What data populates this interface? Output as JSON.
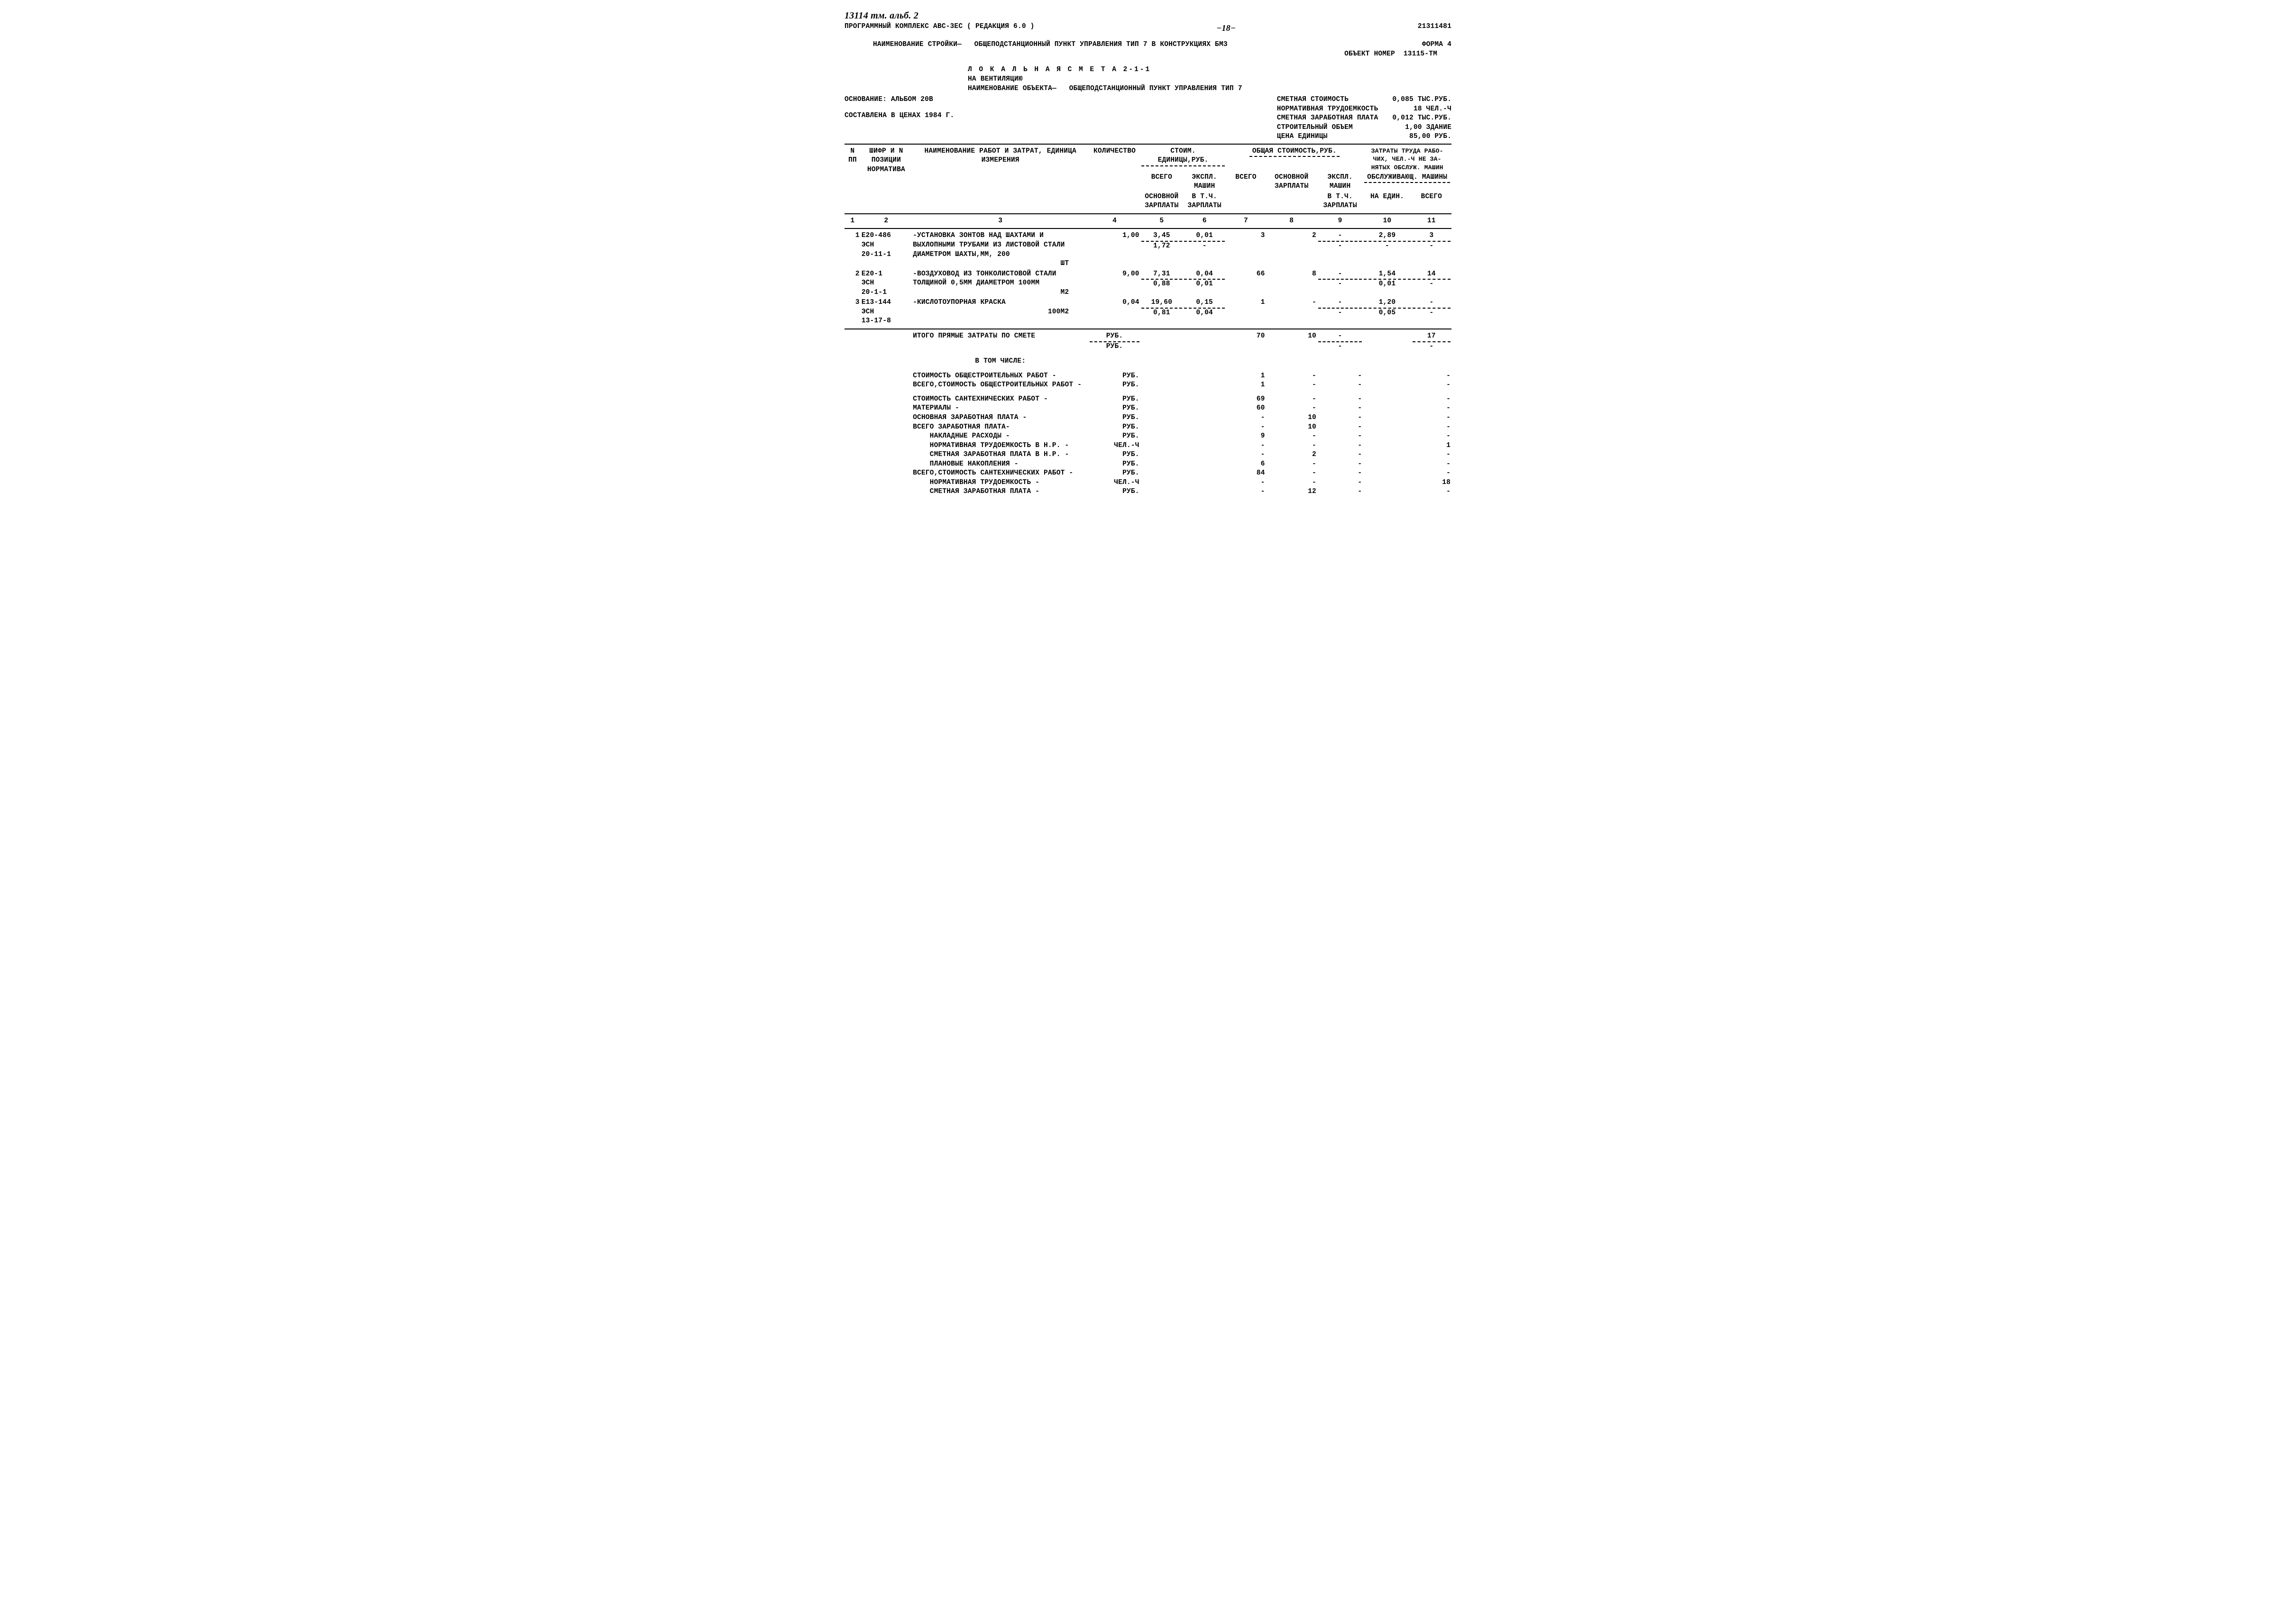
{
  "header": {
    "hand": "13114 тм. альб. 2",
    "prog": "ПРОГРАММНЫЙ КОМПЛЕКС АВС-3ЕС  ( РЕДАКЦИЯ 6.0 )",
    "page": "−18−",
    "code": "21311481",
    "stroika_lbl": "НАИМЕНОВАНИЕ СТРОЙКИ—",
    "stroika_val": "ОБЩЕПОДСТАНЦИОННЫЙ ПУНКТ УПРАВЛЕНИЯ ТИП 7 В КОНСТРУКЦИЯХ БМЗ",
    "forma": "ФОРМА 4",
    "obj_lbl": "ОБЪЕКТ НОМЕР",
    "obj_val": "13115-ТМ",
    "smeta_title": "Л О К А Л Ь Н А Я   С М Е Т А   2-1-1",
    "smeta_on": "НА  ВЕНТИЛЯЦИЮ",
    "obj_name_lbl": "НАИМЕНОВАНИЕ ОБЪЕКТА—",
    "obj_name_val": "ОБЩЕПОДСТАНЦИОННЫЙ ПУНКТ УПРАВЛЕНИЯ ТИП 7",
    "osn": "ОСНОВАНИЕ: АЛЬБОМ 20В",
    "prices": "СОСТАВЛЕНА В ЦЕНАХ 1984 Г."
  },
  "summary": {
    "l1a": "СМЕТНАЯ СТОИМОСТЬ",
    "l1b": "0,085 ТЫС.РУБ.",
    "l2a": "НОРМАТИВНАЯ ТРУДОЕМКОСТЬ",
    "l2b": "18 ЧЕЛ.-Ч",
    "l3a": "СМЕТНАЯ ЗАРАБОТНАЯ ПЛАТА",
    "l3b": "0,012 ТЫС.РУБ.",
    "l4a": "СТРОИТЕЛЬНЫЙ ОБЪЕМ",
    "l4b": "1,00 ЗДАНИЕ",
    "l5a": "ЦЕНА ЕДИНИЦЫ",
    "l5b": "85,00    РУБ."
  },
  "colhdr": {
    "c1a": "N",
    "c1b": "ПП",
    "c2": "ШИФР И N ПОЗИЦИИ НОРМАТИВА",
    "c3": "НАИМЕНОВАНИЕ РАБОТ И ЗАТРАТ, ЕДИНИЦА ИЗМЕРЕНИЯ",
    "c4": "КОЛИЧЕСТВО",
    "c5_top": "СТОИМ. ЕДИНИЦЫ,РУБ.",
    "c5a": "ВСЕГО",
    "c5b": "ЭКСПЛ. МАШИН",
    "c5c": "ОСНОВНОЙ ЗАРПЛАТЫ",
    "c5d": "В Т.Ч. ЗАРПЛАТЫ",
    "c6_top": "ОБЩАЯ СТОИМОСТЬ,РУБ.",
    "c6a": "ВСЕГО",
    "c6b": "ОСНОВНОЙ ЗАРПЛАТЫ",
    "c6c": "ЭКСПЛ. МАШИН",
    "c6d": "В Т.Ч. ЗАРПЛАТЫ",
    "c7_top": "ЗАТРАТЫ ТРУДА РАБО-ЧИХ, ЧЕЛ.-Ч НЕ ЗА-НЯТЫХ ОБСЛУЖ. МАШИН",
    "c7b": "ОБСЛУЖИВАЮЩ. МАШИНЫ",
    "c7c": "НА ЕДИН.",
    "c7d": "ВСЕГО"
  },
  "colnums": {
    "c1": "1",
    "c2": "2",
    "c3": "3",
    "c4": "4",
    "c5": "5",
    "c6": "6",
    "c7": "7",
    "c8": "8",
    "c9": "9",
    "c10": "10",
    "c11": "11"
  },
  "rows": [
    {
      "n": "1",
      "shifr": "Е20-486 ЭСН 20-11-1",
      "name": "-УСТАНОВКА ЗОНТОВ НАД ШАХТАМИ И ВЫХЛОПНЫМИ ТРУБАМИ ИЗ ЛИСТОВОЙ СТАЛИ ДИАМЕТРОМ ШАХТЫ,ММ, 200",
      "unit": "ШТ",
      "qty": "1,00",
      "u_total": "3,45",
      "u_total2": "1,72",
      "u_mach": "0,01",
      "u_mach2": "-",
      "t7": "3",
      "t8": "2",
      "t9": "-",
      "t9b": "-",
      "c10": "2,89",
      "c10b": "-",
      "c11": "3",
      "c11b": "-"
    },
    {
      "n": "2",
      "shifr": "Е20-1 ЭСН 20-1-1",
      "name": "-ВОЗДУХОВОД ИЗ ТОНКОЛИСТОВОЙ СТАЛИ ТОЛЩИНОЙ 0,5ММ ДИАМЕТРОМ 100ММ",
      "unit": "М2",
      "qty": "9,00",
      "u_total": "7,31",
      "u_total2": "0,88",
      "u_mach": "0,04",
      "u_mach2": "0,01",
      "t7": "66",
      "t8": "8",
      "t9": "-",
      "t9b": "-",
      "c10": "1,54",
      "c10b": "0,01",
      "c11": "14",
      "c11b": "-"
    },
    {
      "n": "3",
      "shifr": "Е13-144 ЭСН 13-17-8",
      "name": "-КИСЛОТОУПОРНАЯ КРАСКА",
      "unit": "100М2",
      "qty": "0,04",
      "u_total": "19,60",
      "u_total2": "0,81",
      "u_mach": "0,15",
      "u_mach2": "0,04",
      "t7": "1",
      "t8": "-",
      "t9": "-",
      "t9b": "-",
      "c10": "1,20",
      "c10b": "0,05",
      "c11": "-",
      "c11b": "-"
    }
  ],
  "totals": {
    "direct_lbl": "ИТОГО ПРЯМЫЕ ЗАТРАТЫ ПО СМЕТЕ",
    "direct_unit": "РУБ.",
    "direct_unit2": "РУБ.",
    "d7": "70",
    "d8": "10",
    "d9": "-",
    "d9b": "-",
    "d11": "17",
    "d11b": "-",
    "inthat": "В ТОМ ЧИСЛЕ:"
  },
  "lines": [
    {
      "lbl": "СТОИМОСТЬ ОБЩЕСТРОИТЕЛЬНЫХ РАБОТ -",
      "unit": "РУБ.",
      "v7": "1",
      "v8": "-",
      "v9": "-",
      "v11": "-"
    },
    {
      "lbl": "ВСЕГО,СТОИМОСТЬ ОБЩЕСТРОИТЕЛЬНЫХ РАБОТ -",
      "unit": "РУБ.",
      "v7": "1",
      "v8": "-",
      "v9": "-",
      "v11": "-"
    },
    {
      "spacer": true
    },
    {
      "lbl": "СТОИМОСТЬ САНТЕХНИЧЕСКИХ РАБОТ -",
      "unit": "РУБ.",
      "v7": "69",
      "v8": "-",
      "v9": "-",
      "v11": "-"
    },
    {
      "lbl": "МАТЕРИАЛЫ -",
      "unit": "РУБ.",
      "v7": "60",
      "v8": "-",
      "v9": "-",
      "v11": "-"
    },
    {
      "lbl": "ОСНОВНАЯ ЗАРАБОТНАЯ ПЛАТА -",
      "unit": "РУБ.",
      "v7": "-",
      "v8": "10",
      "v9": "-",
      "v11": "-"
    },
    {
      "lbl": "ВСЕГО ЗАРАБОТНАЯ ПЛАТА-",
      "unit": "РУБ.",
      "v7": "-",
      "v8": "10",
      "v9": "-",
      "v11": "-"
    },
    {
      "lbl": "    НАКЛАДНЫЕ РАСХОДЫ -",
      "unit": "РУБ.",
      "v7": "9",
      "v8": "-",
      "v9": "-",
      "v11": "-"
    },
    {
      "lbl": "    НОРМАТИВНАЯ ТРУДОЕМКОСТЬ В Н.Р. -",
      "unit": "ЧЕЛ.-Ч",
      "v7": "-",
      "v8": "-",
      "v9": "-",
      "v11": "1"
    },
    {
      "lbl": "    СМЕТНАЯ ЗАРАБОТНАЯ ПЛАТА В Н.Р. -",
      "unit": "РУБ.",
      "v7": "-",
      "v8": "2",
      "v9": "-",
      "v11": "-"
    },
    {
      "lbl": "    ПЛАНОВЫЕ НАКОПЛЕНИЯ -",
      "unit": "РУБ.",
      "v7": "6",
      "v8": "-",
      "v9": "-",
      "v11": "-"
    },
    {
      "lbl": "ВСЕГО,СТОИМОСТЬ САНТЕХНИЧЕСКИХ РАБОТ -",
      "unit": "РУБ.",
      "v7": "84",
      "v8": "-",
      "v9": "-",
      "v11": "-"
    },
    {
      "lbl": "    НОРМАТИВНАЯ ТРУДОЕМКОСТЬ -",
      "unit": "ЧЕЛ.-Ч",
      "v7": "-",
      "v8": "-",
      "v9": "-",
      "v11": "18"
    },
    {
      "lbl": "    СМЕТНАЯ ЗАРАБОТНАЯ ПЛАТА -",
      "unit": "РУБ.",
      "v7": "-",
      "v8": "12",
      "v9": "-",
      "v11": "-"
    }
  ]
}
